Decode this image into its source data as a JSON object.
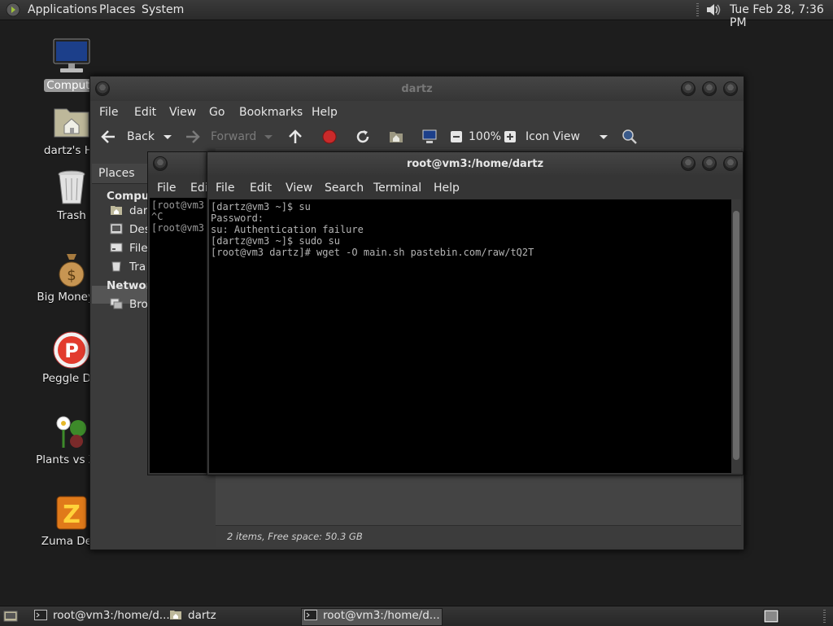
{
  "top_panel": {
    "menus": [
      "Applications",
      "Places",
      "System"
    ],
    "clock": "Tue Feb 28,  7:36 PM"
  },
  "desktop": {
    "icons": [
      {
        "label": "Compute",
        "icon": "computer-icon"
      },
      {
        "label": "dartz's Ho",
        "icon": "home-folder-icon"
      },
      {
        "label": "Trash",
        "icon": "trash-icon"
      },
      {
        "label": "Big Money D",
        "icon": "money-bag-icon"
      },
      {
        "label": "Peggle Del",
        "icon": "peggle-icon"
      },
      {
        "label": "Plants vs Zor",
        "icon": "plants-icon"
      },
      {
        "label": "Zuma Delu",
        "icon": "zuma-icon"
      }
    ]
  },
  "file_manager": {
    "title": "dartz",
    "menu": [
      "File",
      "Edit",
      "View",
      "Go",
      "Bookmarks",
      "Help"
    ],
    "toolbar": {
      "back": "Back",
      "forward": "Forward",
      "zoom": "100%",
      "view_mode": "Icon View"
    },
    "sidebar": {
      "header": "Places",
      "sections": [
        {
          "label": "Comput",
          "items": [
            "dar",
            "Des",
            "File",
            "Tra"
          ]
        },
        {
          "label": "Network",
          "items": [
            "Bro"
          ]
        }
      ]
    },
    "status": "2 items, Free space: 50.3 GB"
  },
  "terminal_back": {
    "menu": [
      "File",
      "Edi"
    ],
    "lines": [
      "[root@vm3",
      "^C",
      "[root@vm3"
    ]
  },
  "terminal_front": {
    "title": "root@vm3:/home/dartz",
    "menu": [
      "File",
      "Edit",
      "View",
      "Search",
      "Terminal",
      "Help"
    ],
    "lines": [
      "[dartz@vm3 ~]$ su",
      "Password:",
      "su: Authentication failure",
      "[dartz@vm3 ~]$ sudo su",
      "[root@vm3 dartz]# wget -O main.sh pastebin.com/raw/tQ2T"
    ]
  },
  "taskbar": {
    "tasks": [
      "root@vm3:/home/d...",
      "dartz",
      "root@vm3:/home/d..."
    ]
  }
}
